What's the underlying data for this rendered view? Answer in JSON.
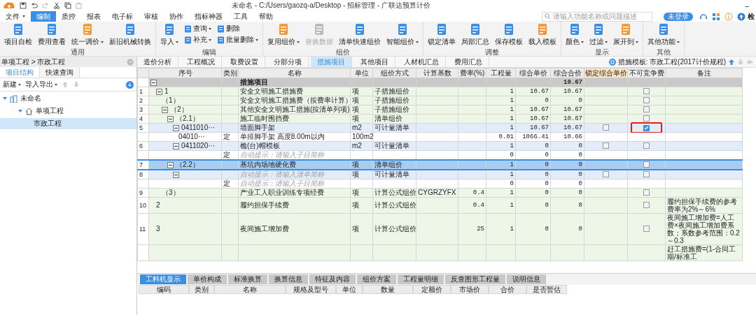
{
  "window": {
    "title": "未命名 - C:/Users/gaozq-a/Desktop - 招标管理 - 广联达预算计价",
    "controls": [
      "–"
    ]
  },
  "menu": [
    {
      "label": "文件",
      "dropdown": true,
      "selected": false
    },
    {
      "label": "编制",
      "dropdown": false,
      "selected": true
    },
    {
      "label": "质控",
      "dropdown": false,
      "selected": false
    },
    {
      "label": "报表",
      "dropdown": false,
      "selected": false
    },
    {
      "label": "电子标",
      "dropdown": false,
      "selected": false
    },
    {
      "label": "审核",
      "dropdown": false,
      "selected": false
    },
    {
      "label": "协作",
      "dropdown": false,
      "selected": false
    },
    {
      "label": "指标神器",
      "dropdown": false,
      "selected": false
    },
    {
      "label": "工具",
      "dropdown": false,
      "selected": false
    },
    {
      "label": "帮助",
      "dropdown": false,
      "selected": false
    }
  ],
  "search": {
    "placeholder": "请输入功能名称或问题描述"
  },
  "login_button": "未登录",
  "check_label": "检",
  "ribbon": [
    {
      "title": "通用",
      "buttons": [
        {
          "label": "项目自检",
          "kind": "large",
          "dropdown": false,
          "disabled": false
        },
        {
          "label": "费用查看",
          "kind": "large",
          "dropdown": false,
          "disabled": false
        },
        {
          "label": "统一调价",
          "kind": "large",
          "dropdown": true,
          "disabled": false
        },
        {
          "label": "新旧机械转换",
          "kind": "large",
          "dropdown": false,
          "disabled": false
        }
      ]
    },
    {
      "title": "编辑",
      "buttons": [
        {
          "label": "导入",
          "kind": "large",
          "dropdown": true,
          "disabled": false
        },
        {
          "label": "查询",
          "kind": "small",
          "dropdown": true,
          "disabled": false
        },
        {
          "label": "补充",
          "kind": "small",
          "dropdown": true,
          "disabled": false
        },
        {
          "label": "删除",
          "kind": "small",
          "dropdown": false,
          "disabled": false
        },
        {
          "label": "批量删除",
          "kind": "small",
          "dropdown": true,
          "disabled": false
        }
      ]
    },
    {
      "title": "组价",
      "buttons": [
        {
          "label": "复用组价",
          "kind": "large",
          "dropdown": true,
          "disabled": false
        },
        {
          "label": "替换数据",
          "kind": "large",
          "dropdown": false,
          "disabled": true
        },
        {
          "label": "清单快速组价",
          "kind": "large",
          "dropdown": false,
          "disabled": false
        },
        {
          "label": "智能组价",
          "kind": "large",
          "dropdown": true,
          "disabled": false
        }
      ]
    },
    {
      "title": "调整",
      "buttons": [
        {
          "label": "锁定清单",
          "kind": "large",
          "dropdown": false,
          "disabled": false
        },
        {
          "label": "局部汇总",
          "kind": "large",
          "dropdown": false,
          "disabled": false
        },
        {
          "label": "保存模板",
          "kind": "large",
          "dropdown": false,
          "disabled": false
        },
        {
          "label": "载入模板",
          "kind": "large",
          "dropdown": false,
          "disabled": false
        }
      ]
    },
    {
      "title": "显示",
      "buttons": [
        {
          "label": "颜色",
          "kind": "large",
          "dropdown": true,
          "disabled": false
        },
        {
          "label": "过滤",
          "kind": "large",
          "dropdown": true,
          "disabled": false
        },
        {
          "label": "展开到",
          "kind": "large",
          "dropdown": true,
          "disabled": false
        }
      ]
    },
    {
      "title": "其他",
      "buttons": [
        {
          "label": "其他功能",
          "kind": "large",
          "dropdown": true,
          "disabled": false
        }
      ]
    }
  ],
  "sidebar": {
    "breadcrumb": "单项工程 > 市政工程",
    "tabs": [
      {
        "label": "项目结构",
        "selected": true
      },
      {
        "label": "快速查询",
        "selected": false
      }
    ],
    "toolbar": [
      {
        "label": "新建",
        "dropdown": true
      },
      {
        "label": "导入导出",
        "dropdown": true
      }
    ],
    "tree": [
      {
        "label": "未命名",
        "selected": false,
        "expanded": true,
        "children": [
          {
            "label": "单项工程",
            "selected": false,
            "expanded": true,
            "children": [
              {
                "label": "市政工程",
                "selected": true
              }
            ]
          }
        ]
      }
    ]
  },
  "tabs": [
    {
      "label": "造价分析",
      "selected": false
    },
    {
      "label": "工程概况",
      "selected": false
    },
    {
      "label": "取费设置",
      "selected": false
    },
    {
      "label": "分部分项",
      "selected": false
    },
    {
      "label": "措施项目",
      "selected": true
    },
    {
      "label": "其他项目",
      "selected": false
    },
    {
      "label": "人材机汇总",
      "selected": false
    },
    {
      "label": "费用汇总",
      "selected": false
    }
  ],
  "template_label": "措施模板: 市政工程(2017计价规程)",
  "table": {
    "columns": [
      "序号",
      "类别",
      "名称",
      "单位",
      "组价方式",
      "计算基数",
      "费率(%)",
      "工程量",
      "综合单价",
      "综合合价",
      "锁定综合单价",
      "不可竞争费",
      "备注"
    ],
    "rows": [
      {
        "kind": "group",
        "name": "措施项目",
        "total": "10.67",
        "selected": false,
        "expanded": true,
        "children": [
          {
            "kind": "measure",
            "num": "1",
            "seq": "1",
            "name": "安全文明施工措施费",
            "unit": "项",
            "method": "子措施组价",
            "qty": "1",
            "price": "10.67",
            "total": "10.67",
            "noncomp_checked": false,
            "selected": false,
            "expanded": true,
            "children": [
              {
                "kind": "measure",
                "num": "2",
                "seq": "（1）",
                "name": "安全文明施工措施费（按费率计算）",
                "unit": "项",
                "method": "子措施组价",
                "qty": "1",
                "price": "0",
                "total": "0",
                "noncomp_checked": false,
                "selected": false
              },
              {
                "kind": "measure",
                "num": "3",
                "seq": "（2）",
                "name": "其他安全文明施工措施(按清单列项)",
                "unit": "项",
                "method": "子措施组价",
                "qty": "1",
                "price": "10.67",
                "total": "10.67",
                "noncomp_checked": false,
                "selected": false,
                "expanded": true,
                "children": [
                  {
                    "kind": "measure",
                    "num": "4",
                    "seq": "（2.1）",
                    "name": "施工临时围挡费",
                    "unit": "项",
                    "method": "清单组价",
                    "qty": "1",
                    "price": "10.67",
                    "total": "10.67",
                    "noncomp_checked": false,
                    "selected": false,
                    "expanded": true,
                    "children": [
                      {
                        "kind": "list",
                        "num": "5",
                        "seq": "0411010···",
                        "name": "墙面脚手架",
                        "unit": "m2",
                        "method": "可计量清单",
                        "qty": "1",
                        "price": "10.67",
                        "total": "10.67",
                        "lock_checked": false,
                        "noncomp_checked": true,
                        "selected": false,
                        "highlighted": true,
                        "expanded": true,
                        "children": [
                          {
                            "kind": "quota",
                            "seq": "04010···",
                            "category": "定",
                            "name": "单排脚手架 高度8.00m以内",
                            "unit": "100m2",
                            "qty": "0.01",
                            "price": "1066.41",
                            "total": "10.66",
                            "selected": false
                          }
                        ]
                      },
                      {
                        "kind": "list",
                        "num": "6",
                        "seq": "0411020···",
                        "name": "檐(台)帽模板",
                        "unit": "m2",
                        "method": "可计量清单",
                        "qty": "1",
                        "price": "0",
                        "total": "0",
                        "lock_checked": false,
                        "noncomp_checked": false,
                        "selected": false,
                        "expanded": true,
                        "children": [
                          {
                            "kind": "quota",
                            "category": "定",
                            "name": "自动提示：请输入子目简称",
                            "qty": "0",
                            "price": "0",
                            "total": "0",
                            "selected": false,
                            "hint": true
                          }
                        ]
                      }
                    ]
                  },
                  {
                    "kind": "list",
                    "num": "7",
                    "seq": "（2.2）",
                    "name": "基坑内场地硬化费",
                    "unit": "项",
                    "method": "清单组价",
                    "qty": "1",
                    "price": "0",
                    "total": "0",
                    "noncomp_checked": false,
                    "selected": true,
                    "expanded": true,
                    "children": [
                      {
                        "kind": "list",
                        "num": "8",
                        "name": "自动提示：请输入清单简称",
                        "unit": "项",
                        "method": "可计量清单",
                        "qty": "1",
                        "price": "0",
                        "total": "0",
                        "lock_checked": false,
                        "noncomp_checked": false,
                        "selected": false,
                        "hint": true,
                        "expanded": true,
                        "children": [
                          {
                            "kind": "quota",
                            "category": "定",
                            "name": "自动提示：请输入子目简称",
                            "qty": "0",
                            "price": "0",
                            "total": "0",
                            "selected": false,
                            "hint": true
                          }
                        ]
                      }
                    ]
                  }
                ]
              },
              {
                "kind": "measure",
                "num": "9",
                "seq": "（3）",
                "name": "产业工人职业训练专项经费",
                "unit": "项",
                "method": "计算公式组价",
                "base": "CYGRZYFX",
                "rate": "0.4",
                "qty": "1",
                "price": "0",
                "total": "0",
                "noncomp_checked": false,
                "selected": false
              }
            ]
          },
          {
            "kind": "measure",
            "num": "10",
            "seq": "2",
            "name": "履约担保手续费",
            "unit": "项",
            "method": "计算公式组价",
            "rate": "0.4",
            "qty": "1",
            "price": "0",
            "total": "0",
            "noncomp_checked": false,
            "remark": "履约担保手续费的参考费率为2%～6%",
            "selected": false
          },
          {
            "kind": "measure",
            "num": "11",
            "seq": "3",
            "name": "夜间施工增加费",
            "unit": "项",
            "method": "计算公式组价",
            "rate": "25",
            "qty": "1",
            "price": "0",
            "total": "0",
            "noncomp_checked": false,
            "remark": "夜间施工增加费=人工费×夜间施工增加费系数；系数参考范围：0.2～0.3",
            "selected": false
          },
          {
            "kind": "measure",
            "remark": "赶工措施费=(1-合同工期/标准工",
            "selected": false
          }
        ]
      }
    ]
  },
  "bottom_tabs": [
    {
      "label": "工料机显示",
      "selected": true
    },
    {
      "label": "单价构成",
      "selected": false
    },
    {
      "label": "标准换算",
      "selected": false
    },
    {
      "label": "换算信息",
      "selected": false
    },
    {
      "label": "特征及内容",
      "selected": false
    },
    {
      "label": "组价方案",
      "selected": false
    },
    {
      "label": "工程量明细",
      "selected": false
    },
    {
      "label": "反查图形工程量",
      "selected": false
    },
    {
      "label": "说明信息",
      "selected": false
    }
  ],
  "bottom_table": {
    "columns": [
      "编码",
      "类别",
      "名称",
      "规格及型号",
      "单位",
      "数量",
      "定额价",
      "市场价",
      "合价",
      "是否暂估"
    ]
  }
}
